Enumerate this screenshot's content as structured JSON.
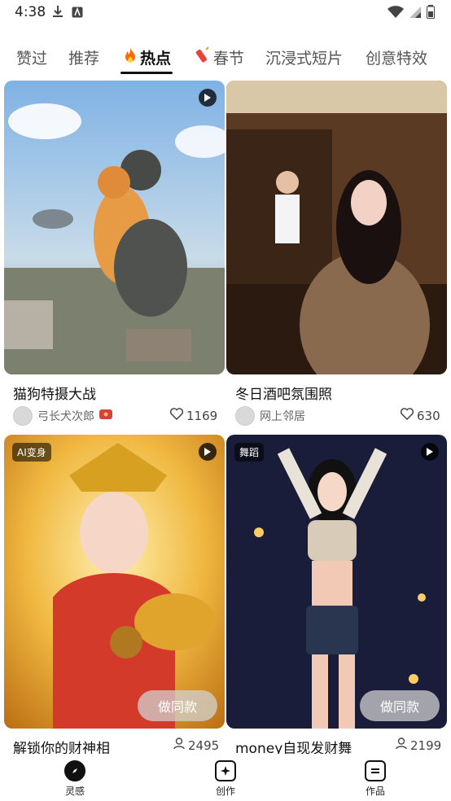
{
  "status": {
    "time": "4:38"
  },
  "tabs": [
    {
      "label": "赞过",
      "icon": ""
    },
    {
      "label": "推荐",
      "icon": ""
    },
    {
      "label": "热点",
      "icon": "fire-icon"
    },
    {
      "label": "春节",
      "icon": "firecracker-icon"
    },
    {
      "label": "沉浸式短片",
      "icon": ""
    },
    {
      "label": "创意特效",
      "icon": ""
    }
  ],
  "cards": [
    {
      "title": "猫狗特摄大战",
      "author": "弓长犬次郎",
      "likes": "1169"
    },
    {
      "title": "冬日酒吧氛围照",
      "author": "网上邻居",
      "likes": "630"
    },
    {
      "badge": "AI变身",
      "button": "做同款",
      "title": "解锁你的财神相",
      "count": "2495"
    },
    {
      "badge": "舞蹈",
      "button": "做同款",
      "title": "money自现发财舞",
      "count": "2199"
    }
  ],
  "bottom_nav": [
    {
      "label": "灵感",
      "icon": "compass-icon"
    },
    {
      "label": "创作",
      "icon": "sparkle-icon"
    },
    {
      "label": "作品",
      "icon": "list-icon"
    }
  ],
  "colors": {
    "accent": "#111111",
    "fire": "#ff6a00",
    "like": "#444444"
  }
}
